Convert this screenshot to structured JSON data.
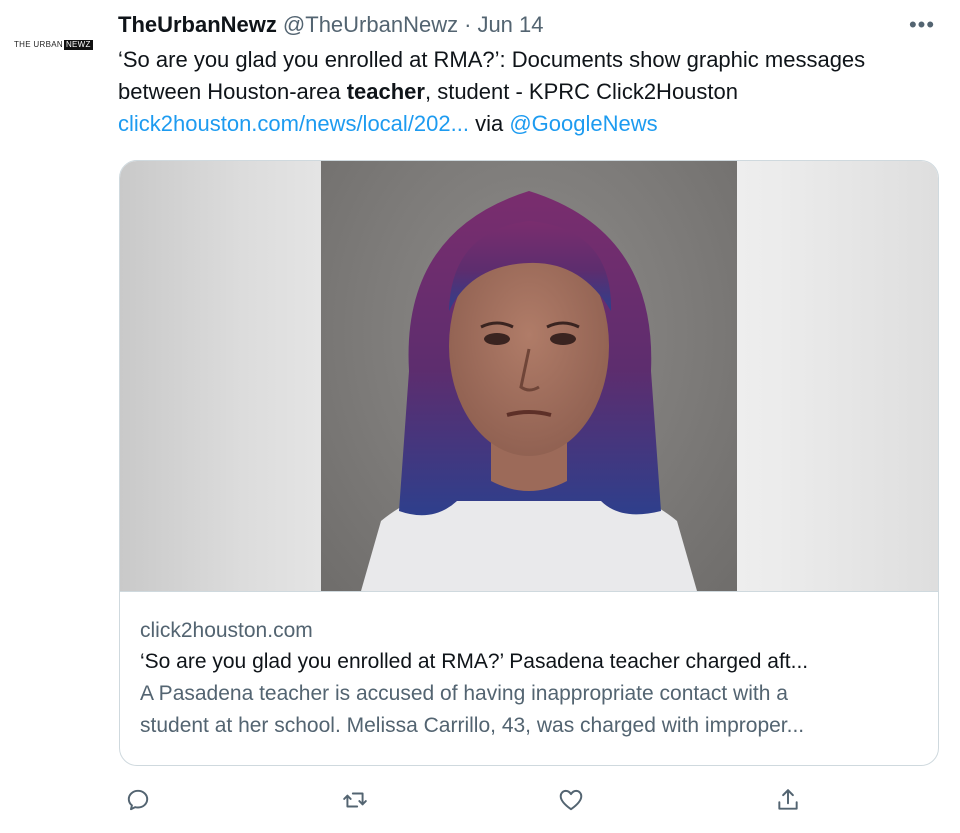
{
  "author": {
    "display_name": "TheUrbanNewz",
    "handle": "@TheUrbanNewz",
    "separator": "·",
    "date": "Jun 14",
    "avatar_logo_a": "THE URBAN",
    "avatar_logo_b": "NEWZ"
  },
  "more_label": "•••",
  "tweet": {
    "text_part1": "‘So are you glad you enrolled at RMA?’: Documents show graphic messages between Houston-area ",
    "text_bold": "teacher",
    "text_part2": ", student - KPRC Click2Houston",
    "link": "click2houston.com/news/local/202...",
    "via": "via",
    "mention": "@GoogleNews"
  },
  "card": {
    "domain": "click2houston.com",
    "title": "‘So are you glad you enrolled at RMA?’ Pasadena teacher charged aft...",
    "description_line1": "A Pasadena teacher is accused of having inappropriate contact with a",
    "description_line2": "student at her school. Melissa Carrillo, 43, was charged with improper..."
  },
  "actions": [
    "reply-icon",
    "retweet-icon",
    "like-icon",
    "share-icon"
  ],
  "colors": {
    "accent": "#1d9bf0",
    "secondary_text": "#536471",
    "border": "#cfd9de"
  }
}
